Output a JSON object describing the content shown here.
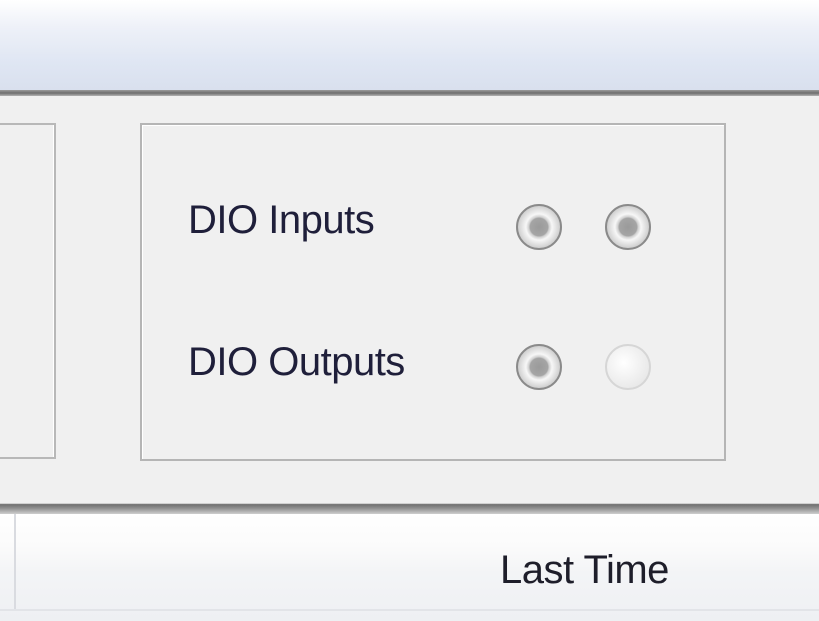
{
  "dio_panel": {
    "inputs_label": "DIO Inputs",
    "outputs_label": "DIO Outputs",
    "inputs_leds": [
      {
        "state": "on",
        "icon": "led-indicator-icon"
      },
      {
        "state": "on",
        "icon": "led-indicator-icon"
      }
    ],
    "outputs_leds": [
      {
        "state": "on",
        "icon": "led-indicator-icon"
      },
      {
        "state": "off",
        "icon": "led-indicator-icon"
      }
    ]
  },
  "table": {
    "columns": [
      "Last Time"
    ]
  }
}
